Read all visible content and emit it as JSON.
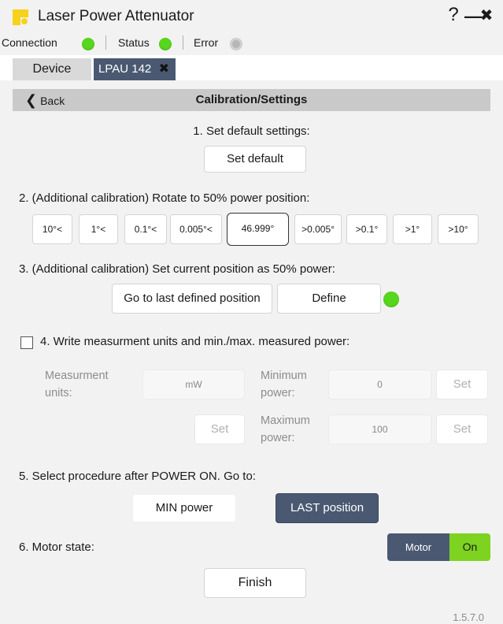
{
  "window": {
    "title": "Laser Power Attenuator",
    "help_glyph": "?",
    "minimize_glyph": "—",
    "close_glyph": "✖"
  },
  "status": {
    "connection_label": "Connection",
    "status_label": "Status",
    "error_label": "Error",
    "connection_color": "#56d61c",
    "status_color": "#56d61c",
    "error_color": "#b6b6b6"
  },
  "tabs": {
    "device_label": "Device",
    "active_label": "LPAU 142",
    "close_glyph": "✖"
  },
  "header": {
    "back_label": "Back",
    "back_glyph": "❮",
    "title": "Calibration/Settings"
  },
  "step1": {
    "label": "1. Set default settings:",
    "button": "Set default"
  },
  "step2": {
    "label": "2. (Additional calibration) Rotate to 50% power position:",
    "left_buttons": [
      "10°<",
      "1°<",
      "0.1°<",
      "0.005°<"
    ],
    "current_position": "46.999°",
    "right_buttons": [
      ">0.005°",
      ">0.1°",
      ">1°",
      ">10°"
    ]
  },
  "step3": {
    "label": "3. (Additional calibration) Set current position as 50% power:",
    "goto_button": "Go to last defined position",
    "define_button": "Define",
    "indicator_color": "#56d61c"
  },
  "step4": {
    "label": "4. Write measurment units and min./max. measured power:",
    "checked": false,
    "units_label": "Measurment units:",
    "units_value": "mW",
    "min_label": "Minimum power:",
    "min_value": "0",
    "max_label": "Maximum power:",
    "max_value": "100",
    "set_label": "Set"
  },
  "step5": {
    "label": "5. Select procedure after POWER ON. Go to:",
    "min_button": "MIN power",
    "last_button": "LAST position",
    "selected": "LAST position"
  },
  "step6": {
    "label": "6. Motor state:",
    "toggle_left": "Motor",
    "toggle_right": "On"
  },
  "finish_button": "Finish",
  "version": "1.5.7.0",
  "colors": {
    "accent_dark": "#4a5971",
    "green": "#7ed321",
    "logo_yellow": "#f6d21c"
  }
}
